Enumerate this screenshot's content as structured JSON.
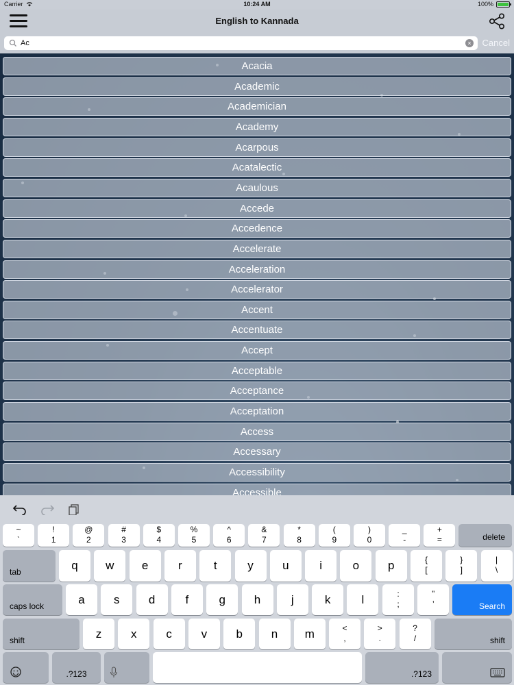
{
  "status_bar": {
    "carrier": "Carrier",
    "time": "10:24 AM",
    "battery": "100%",
    "battery_level": 1.0
  },
  "nav": {
    "title": "English to Kannada",
    "menu_icon": "hamburger-icon",
    "share_icon": "share-icon"
  },
  "search": {
    "value": "Ac",
    "placeholder": "",
    "cancel_label": "Cancel",
    "clear_icon": "clear-icon"
  },
  "words": [
    "Acacia",
    "Academic",
    "Academician",
    "Academy",
    "Acarpous",
    "Acatalectic",
    "Acaulous",
    "Accede",
    "Accedence",
    "Accelerate",
    "Acceleration",
    "Accelerator",
    "Accent",
    "Accentuate",
    "Accept",
    "Acceptable",
    "Acceptance",
    "Acceptation",
    "Access",
    "Accessary",
    "Accessibility",
    "Accessible"
  ],
  "keyboard": {
    "toolbar": [
      "undo-icon",
      "redo-icon",
      "paste-icon"
    ],
    "number_row": [
      {
        "top": "~",
        "bottom": "`"
      },
      {
        "top": "!",
        "bottom": "1"
      },
      {
        "top": "@",
        "bottom": "2"
      },
      {
        "top": "#",
        "bottom": "3"
      },
      {
        "top": "$",
        "bottom": "4"
      },
      {
        "top": "%",
        "bottom": "5"
      },
      {
        "top": "^",
        "bottom": "6"
      },
      {
        "top": "&",
        "bottom": "7"
      },
      {
        "top": "*",
        "bottom": "8"
      },
      {
        "top": "(",
        "bottom": "9"
      },
      {
        "top": ")",
        "bottom": "0"
      },
      {
        "top": "_",
        "bottom": "-"
      },
      {
        "top": "+",
        "bottom": "="
      }
    ],
    "delete_label": "delete",
    "tab_label": "tab",
    "row2": [
      "q",
      "w",
      "e",
      "r",
      "t",
      "y",
      "u",
      "i",
      "o",
      "p"
    ],
    "row2_extra": [
      {
        "top": "{",
        "bottom": "["
      },
      {
        "top": "}",
        "bottom": "]"
      },
      {
        "top": "|",
        "bottom": "\\"
      }
    ],
    "caps_label": "caps lock",
    "row3": [
      "a",
      "s",
      "d",
      "f",
      "g",
      "h",
      "j",
      "k",
      "l"
    ],
    "row3_extra": [
      {
        "top": ":",
        "bottom": ";"
      },
      {
        "top": "”",
        "bottom": "’"
      }
    ],
    "search_label": "Search",
    "shift_label": "shift",
    "row4": [
      "z",
      "x",
      "c",
      "v",
      "b",
      "n",
      "m"
    ],
    "row4_extra": [
      {
        "top": "<",
        "bottom": ","
      },
      {
        "top": ">",
        "bottom": "."
      },
      {
        "top": "?",
        "bottom": "/"
      }
    ],
    "numbers_label": ".?123",
    "emoji_icon": "emoji-icon",
    "mic_icon": "microphone-icon",
    "hide_icon": "keyboard-hide-icon",
    "accent_color": "#1a7cf5"
  }
}
